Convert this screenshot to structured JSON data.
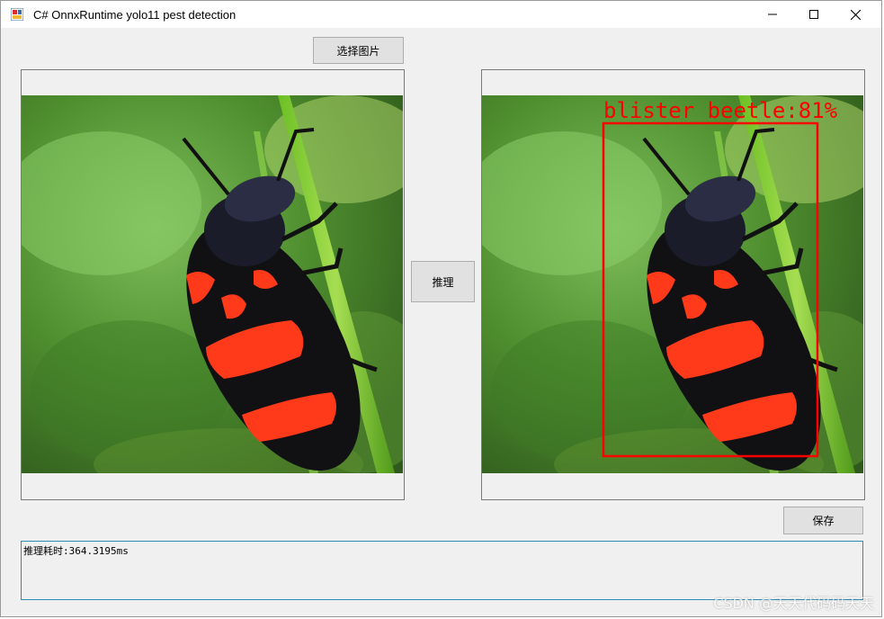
{
  "window": {
    "title": "C# OnnxRuntime yolo11 pest detection"
  },
  "buttons": {
    "select_image": "选择图片",
    "infer": "推理",
    "save": "保存"
  },
  "detection": {
    "label": "blister beetle:81%",
    "color": "#ff0000"
  },
  "output": {
    "text": "推理耗时:364.3195ms"
  },
  "watermark": "CSDN @天天代码码天天"
}
